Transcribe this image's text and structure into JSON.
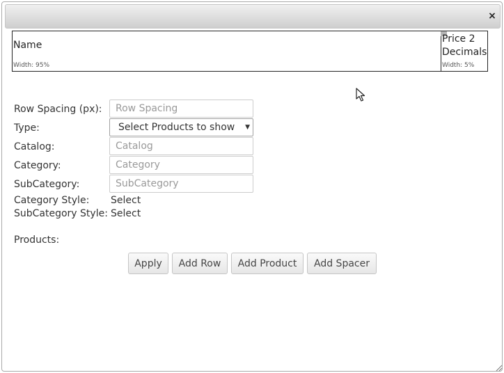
{
  "dialog": {
    "close_icon": "close-icon",
    "close_glyph": "×"
  },
  "columns": [
    {
      "title": "Name",
      "width_label": "Width: 95%"
    },
    {
      "title": "Price 2 Decimals",
      "width_label": "Width: 5%"
    }
  ],
  "form": {
    "row_spacing": {
      "label": "Row Spacing (px):",
      "placeholder": "Row Spacing",
      "value": ""
    },
    "type": {
      "label": "Type:",
      "selected": "Select Products to show"
    },
    "catalog": {
      "label": "Catalog:",
      "placeholder": "Catalog",
      "value": ""
    },
    "category": {
      "label": "Category:",
      "placeholder": "Category",
      "value": ""
    },
    "subcategory": {
      "label": "SubCategory:",
      "placeholder": "SubCategory",
      "value": ""
    },
    "category_style": {
      "label": "Category Style:",
      "value": "Select"
    },
    "subcategory_style": {
      "label": "SubCategory Style:",
      "value": "Select"
    },
    "products": {
      "label": "Products:"
    }
  },
  "buttons": {
    "apply": "Apply",
    "add_row": "Add Row",
    "add_product": "Add Product",
    "add_spacer": "Add Spacer"
  }
}
